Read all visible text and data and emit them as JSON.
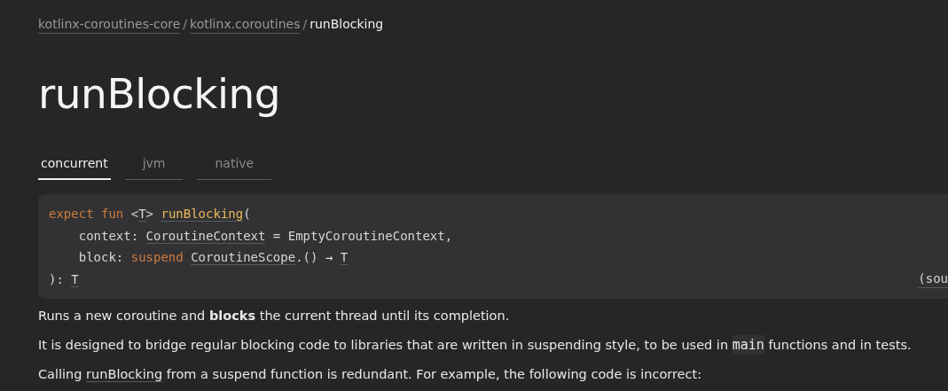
{
  "breadcrumbs": [
    {
      "label": "kotlinx-coroutines-core",
      "kind": "link"
    },
    {
      "label": "kotlinx.coroutines",
      "kind": "link"
    },
    {
      "label": "runBlocking",
      "kind": "current"
    }
  ],
  "breadcrumb_separator": "/",
  "title": "runBlocking",
  "tabs": [
    {
      "label": "concurrent",
      "selected": true
    },
    {
      "label": "jvm",
      "selected": false
    },
    {
      "label": "native",
      "selected": false
    }
  ],
  "signature": {
    "lines": [
      [
        {
          "text": "expect fun ",
          "kind": "keyword"
        },
        {
          "text": "<",
          "kind": "plain"
        },
        {
          "text": "T",
          "kind": "type"
        },
        {
          "text": "> ",
          "kind": "plain"
        },
        {
          "text": "runBlocking",
          "kind": "function"
        },
        {
          "text": "(",
          "kind": "plain"
        }
      ],
      [
        {
          "text": "    context: ",
          "kind": "plain"
        },
        {
          "text": "CoroutineContext",
          "kind": "type"
        },
        {
          "text": " = EmptyCoroutineContext,",
          "kind": "plain"
        }
      ],
      [
        {
          "text": "    block: ",
          "kind": "plain"
        },
        {
          "text": "suspend ",
          "kind": "keyword"
        },
        {
          "text": "CoroutineScope",
          "kind": "type"
        },
        {
          "text": ".() → ",
          "kind": "plain"
        },
        {
          "text": "T",
          "kind": "type"
        }
      ],
      [
        {
          "text": "): ",
          "kind": "plain"
        },
        {
          "text": "T",
          "kind": "type"
        }
      ]
    ],
    "source_link": "(sou"
  },
  "paragraphs": [
    [
      {
        "kind": "text",
        "text": "Runs a new coroutine and **blocks** the current thread until its completion."
      }
    ],
    [
      {
        "kind": "text",
        "text": "It is designed to bridge regular blocking code to libraries that are written in suspending style, to be used in "
      },
      {
        "kind": "code",
        "text": "main"
      },
      {
        "kind": "text",
        "text": " functions and in tests."
      }
    ],
    [
      {
        "kind": "text",
        "text": "Calling "
      },
      {
        "kind": "link",
        "text": "runBlocking"
      },
      {
        "kind": "text",
        "text": " from a suspend function is redundant. For example, the following code is incorrect:"
      }
    ]
  ]
}
